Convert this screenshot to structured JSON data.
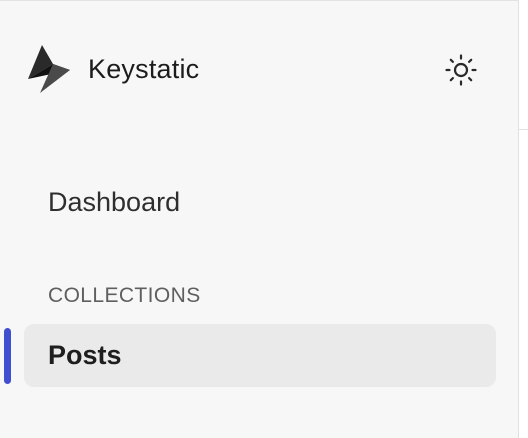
{
  "sidebar": {
    "brand": {
      "name": "Keystatic",
      "logo_icon": "lightning-bolt-icon"
    },
    "theme_toggle": {
      "icon": "sun-icon"
    },
    "nav": {
      "dashboard_label": "Dashboard",
      "collections_heading": "COLLECTIONS",
      "collections": [
        {
          "label": "Posts",
          "active": true
        }
      ]
    },
    "colors": {
      "accent": "#3f4fd0",
      "background": "#f7f7f7",
      "active_item_bg": "#eaeaea"
    }
  }
}
